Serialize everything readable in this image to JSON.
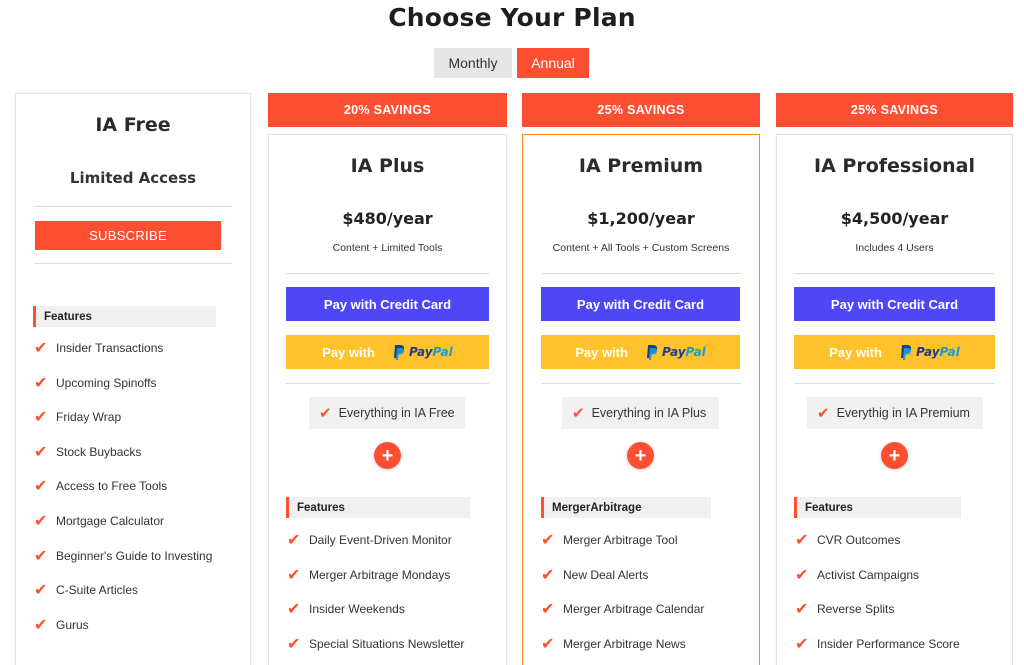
{
  "page": {
    "title": "Choose Your Plan"
  },
  "billing_toggle": {
    "monthly": "Monthly",
    "annual": "Annual"
  },
  "colors": {
    "accent": "#ff4f33",
    "credit_card": "#4f46f5",
    "paypal": "#ffc22b",
    "highlight_border": "#ff8a1c"
  },
  "plans": [
    {
      "name": "IA Free",
      "subtitle": "Limited Access",
      "subscribe_label": "SUBSCRIBE",
      "features_label": "Features",
      "features": [
        "Insider Transactions",
        "Upcoming Spinoffs",
        "Friday Wrap",
        "Stock Buybacks",
        "Access to Free Tools",
        "Mortgage Calculator",
        "Beginner's Guide to Investing",
        "C-Suite Articles",
        "Gurus"
      ]
    },
    {
      "savings": "20% SAVINGS",
      "name": "IA Plus",
      "price": "$480/year",
      "price_note": "Content + Limited Tools",
      "credit_card_label": "Pay with Credit Card",
      "paypal_label": "Pay with",
      "paypal_brand": {
        "pay": "Pay",
        "pal": "Pal"
      },
      "includes": "Everything in IA Free",
      "features_label": "Features",
      "features": [
        "Daily Event-Driven Monitor",
        "Merger Arbitrage Mondays",
        "Insider Weekends",
        "Special Situations Newsletter"
      ]
    },
    {
      "savings": "25% SAVINGS",
      "name": "IA Premium",
      "price": "$1,200/year",
      "price_note": "Content + All Tools + Custom Screens",
      "credit_card_label": "Pay with Credit Card",
      "paypal_label": "Pay with",
      "paypal_brand": {
        "pay": "Pay",
        "pal": "Pal"
      },
      "includes": "Everything in IA Plus",
      "features_label": "MergerArbitrage",
      "features": [
        "Merger Arbitrage Tool",
        "New Deal Alerts",
        "Merger Arbitrage Calendar",
        "Merger Arbitrage News"
      ]
    },
    {
      "savings": "25% SAVINGS",
      "name": "IA Professional",
      "price": "$4,500/year",
      "price_note": "Includes 4 Users",
      "credit_card_label": "Pay with Credit Card",
      "paypal_label": "Pay with",
      "paypal_brand": {
        "pay": "Pay",
        "pal": "Pal"
      },
      "includes": "Everythig in IA Premium",
      "features_label": "Features",
      "features": [
        "CVR Outcomes",
        "Activist Campaigns",
        "Reverse Splits",
        "Insider Performance Score"
      ]
    }
  ]
}
